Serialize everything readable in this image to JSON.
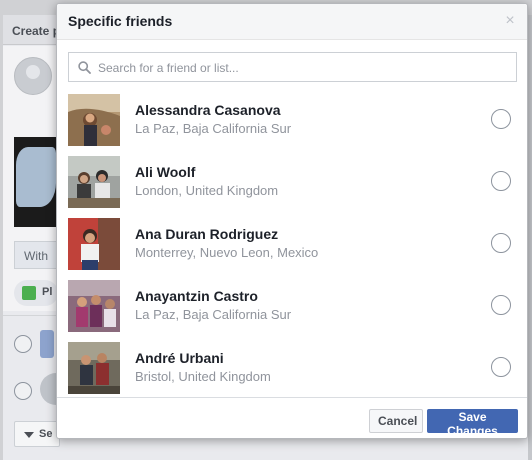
{
  "background": {
    "panel_title": "Create p",
    "with_label": "With",
    "photo_button_label": "Pl",
    "select_label": "Se"
  },
  "modal": {
    "title": "Specific friends",
    "close_symbol": "×",
    "search": {
      "placeholder": "Search for a friend or list...",
      "value": ""
    },
    "friends": [
      {
        "name": "Alessandra Casanova",
        "location": "La Paz, Baja California Sur",
        "selected": false
      },
      {
        "name": "Ali Woolf",
        "location": "London, United Kingdom",
        "selected": false
      },
      {
        "name": "Ana Duran Rodriguez",
        "location": "Monterrey, Nuevo Leon, Mexico",
        "selected": false
      },
      {
        "name": "Anayantzin Castro",
        "location": "La Paz, Baja California Sur",
        "selected": false
      },
      {
        "name": "André Urbani",
        "location": "Bristol, United Kingdom",
        "selected": false
      }
    ],
    "buttons": {
      "cancel": "Cancel",
      "save": "Save Changes"
    }
  },
  "colors": {
    "accent": "#4267b2",
    "name_text": "#1d2129",
    "secondary_text": "#90949c"
  }
}
